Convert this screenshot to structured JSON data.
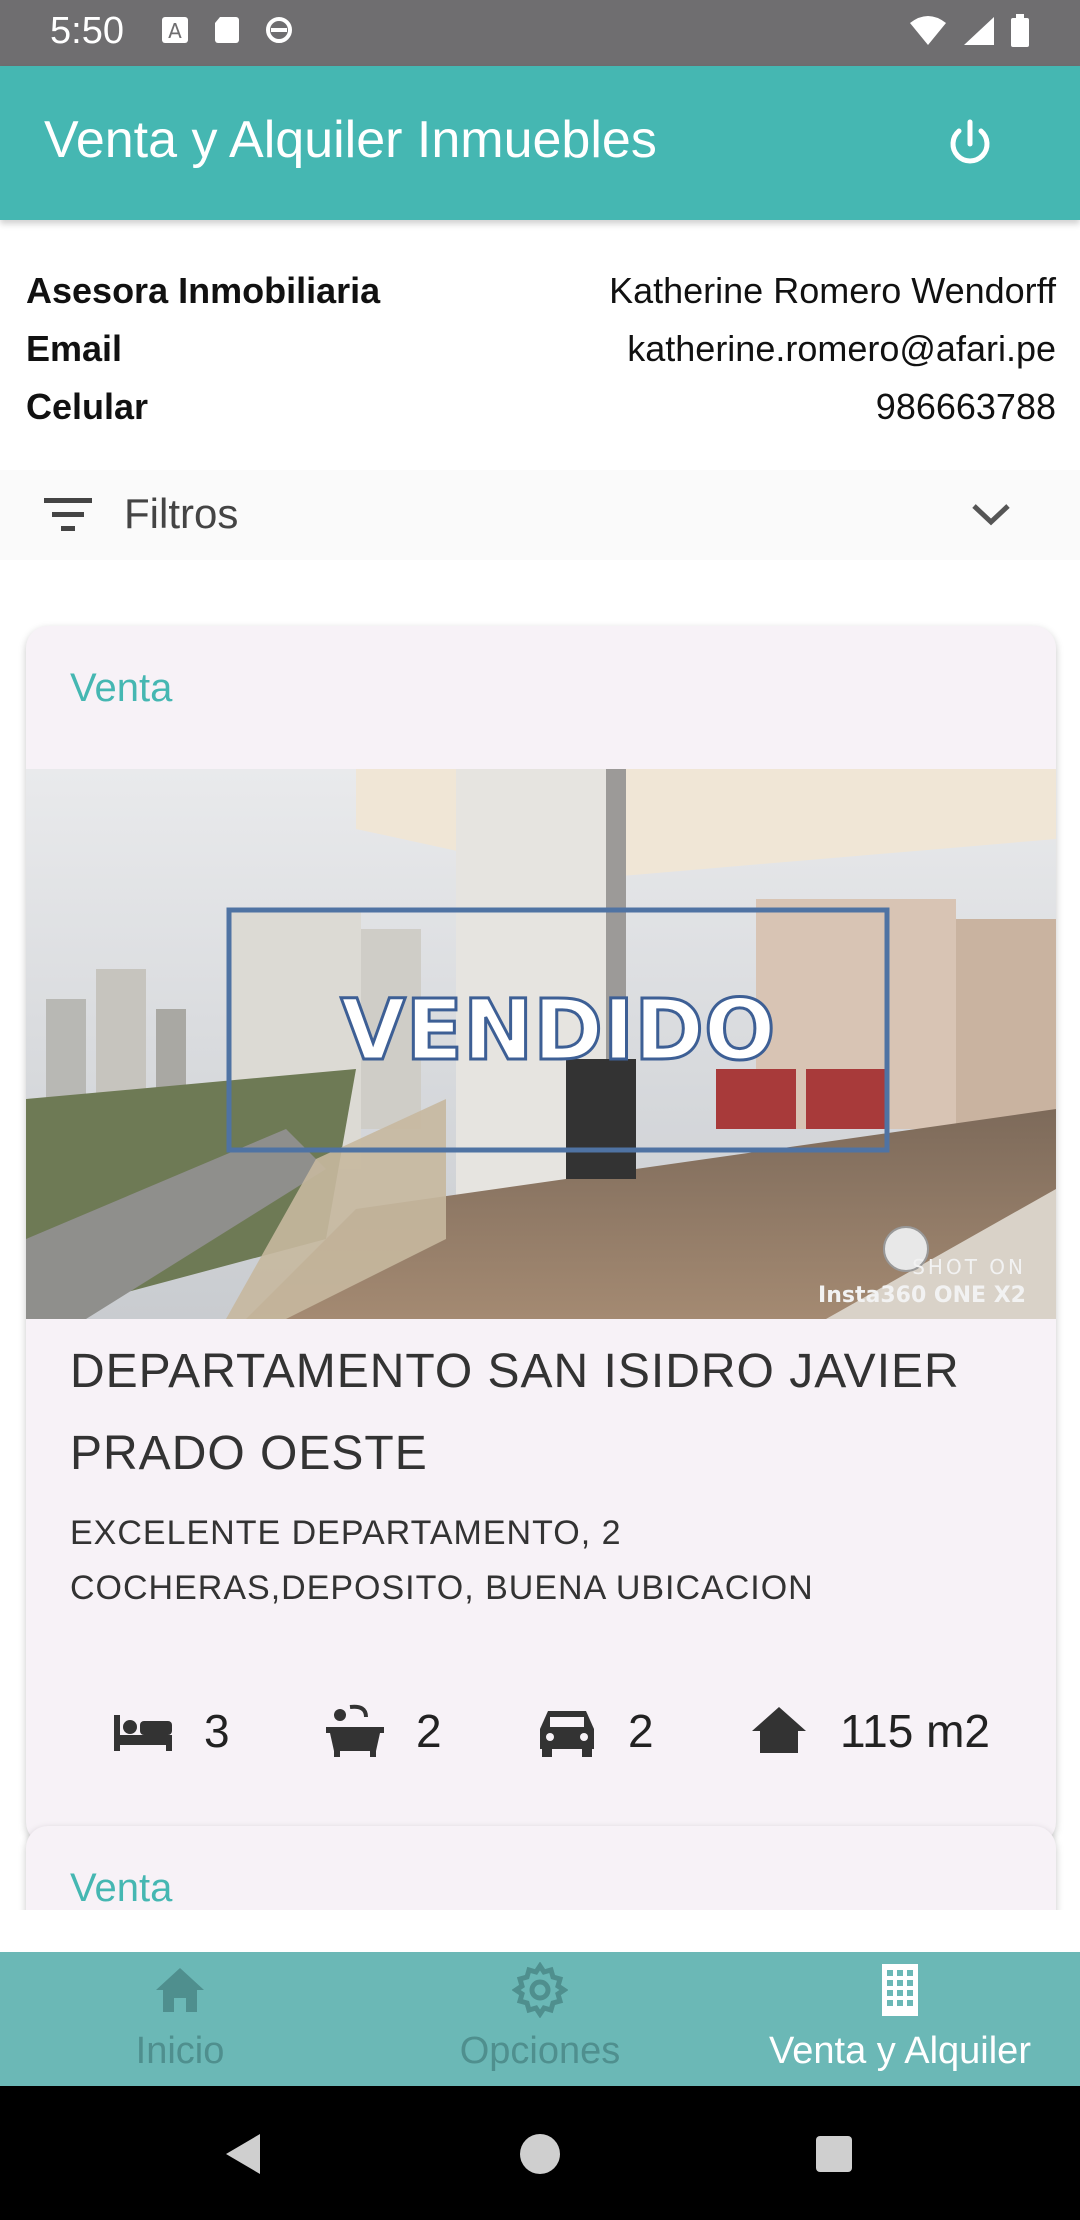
{
  "status_bar": {
    "time": "5:50"
  },
  "app_bar": {
    "title": "Venta y Alquiler Inmuebles"
  },
  "advisor": {
    "rows": [
      {
        "label": "Asesora Inmobiliaria",
        "value": "Katherine Romero Wendorff"
      },
      {
        "label": "Email",
        "value": "katherine.romero@afari.pe"
      },
      {
        "label": "Celular",
        "value": "986663788"
      }
    ]
  },
  "filters": {
    "label": "Filtros"
  },
  "listings": [
    {
      "type": "Venta",
      "photo_overlay": "VENDIDO",
      "photo_watermark_1": "SHOT ON",
      "photo_watermark_2": "Insta360 ONE X2",
      "title": "DEPARTAMENTO SAN ISIDRO JAVIER PRADO OESTE",
      "description": "EXCELENTE DEPARTAMENTO, 2 COCHERAS,DEPOSITO, BUENA UBICACION",
      "bedrooms": "3",
      "bathrooms": "2",
      "parking": "2",
      "area": "115 m2"
    },
    {
      "type": "Venta"
    }
  ],
  "bottom_nav": {
    "items": [
      {
        "label": "Inicio",
        "icon": "home-icon"
      },
      {
        "label": "Opciones",
        "icon": "gear-icon"
      },
      {
        "label": "Venta y Alquiler",
        "icon": "building-icon"
      }
    ],
    "active": "Venta y Alquiler"
  },
  "colors": {
    "primary": "#45b7b2",
    "bottom_nav": "#6bb8b6",
    "card": "#f7f2f7"
  }
}
